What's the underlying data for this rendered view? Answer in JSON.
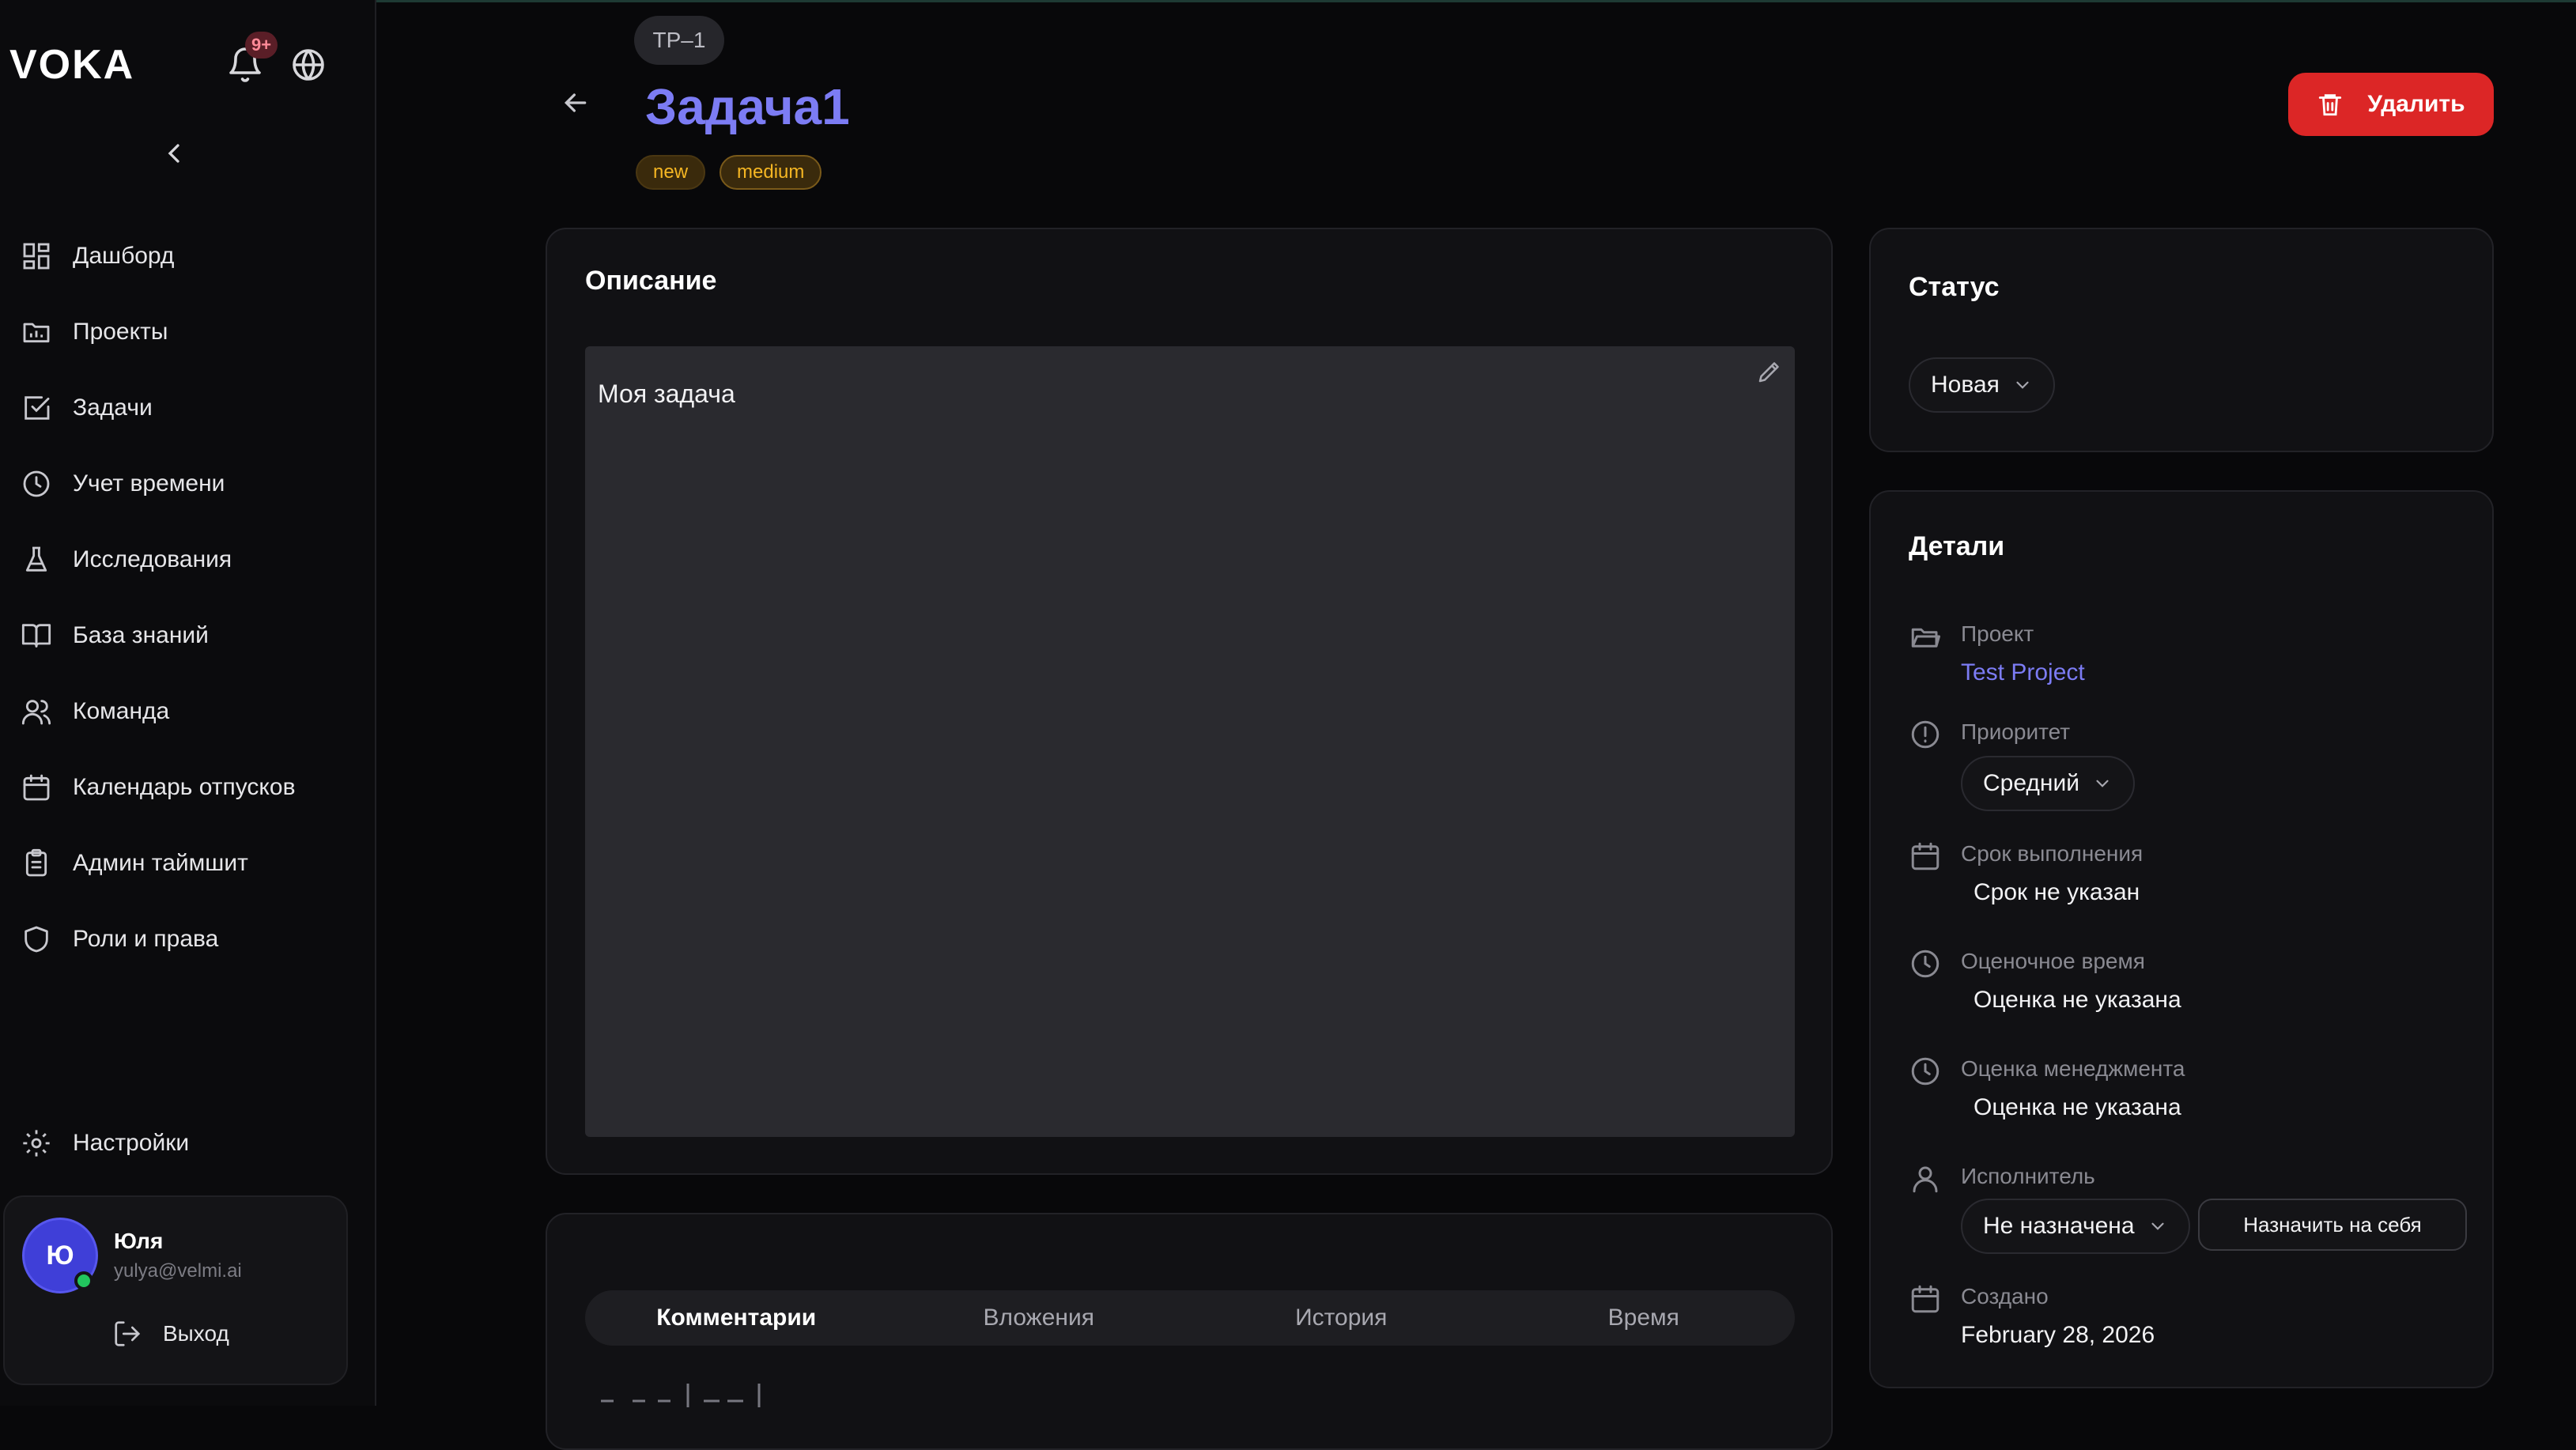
{
  "app": {
    "logo": "VOKA",
    "notifications_badge": "9+"
  },
  "sidebar": {
    "items": [
      {
        "label": "Дашборд",
        "icon": "dashboard-icon"
      },
      {
        "label": "Проекты",
        "icon": "folder-icon"
      },
      {
        "label": "Задачи",
        "icon": "checkbox-icon"
      },
      {
        "label": "Учет времени",
        "icon": "clock-icon"
      },
      {
        "label": "Исследования",
        "icon": "flask-icon"
      },
      {
        "label": "База знаний",
        "icon": "book-icon"
      },
      {
        "label": "Команда",
        "icon": "users-icon"
      },
      {
        "label": "Календарь отпусков",
        "icon": "calendar-icon"
      },
      {
        "label": "Админ таймшит",
        "icon": "clipboard-icon"
      },
      {
        "label": "Роли и права",
        "icon": "shield-icon"
      }
    ],
    "settings_label": "Настройки",
    "user": {
      "initial": "Ю",
      "name": "Юля",
      "email": "yulya@velmi.ai",
      "logout_label": "Выход"
    }
  },
  "task": {
    "key": "TP–1",
    "title": "Задача1",
    "tags": [
      "new",
      "medium"
    ],
    "delete_label": "Удалить"
  },
  "description": {
    "title": "Описание",
    "text": "Моя задача"
  },
  "tabs": [
    "Комментарии",
    "Вложения",
    "История",
    "Время"
  ],
  "status": {
    "title": "Статус",
    "value": "Новая"
  },
  "details": {
    "title": "Детали",
    "project_label": "Проект",
    "project_value": "Test Project",
    "priority_label": "Приоритет",
    "priority_value": "Средний",
    "due_label": "Срок выполнения",
    "due_value": "Срок не указан",
    "estimate_label": "Оценочное время",
    "estimate_value": "Оценка не указана",
    "mgmt_label": "Оценка менеджмента",
    "mgmt_value": "Оценка не указана",
    "assignee_label": "Исполнитель",
    "assignee_value": "Не назначена",
    "assign_self_label": "Назначить на себя",
    "created_label": "Создано",
    "created_value": "February 28, 2026"
  },
  "colors": {
    "accent": "#7c7cf4",
    "danger": "#dc2626",
    "tag": "#f5b623",
    "online": "#22c55e"
  }
}
